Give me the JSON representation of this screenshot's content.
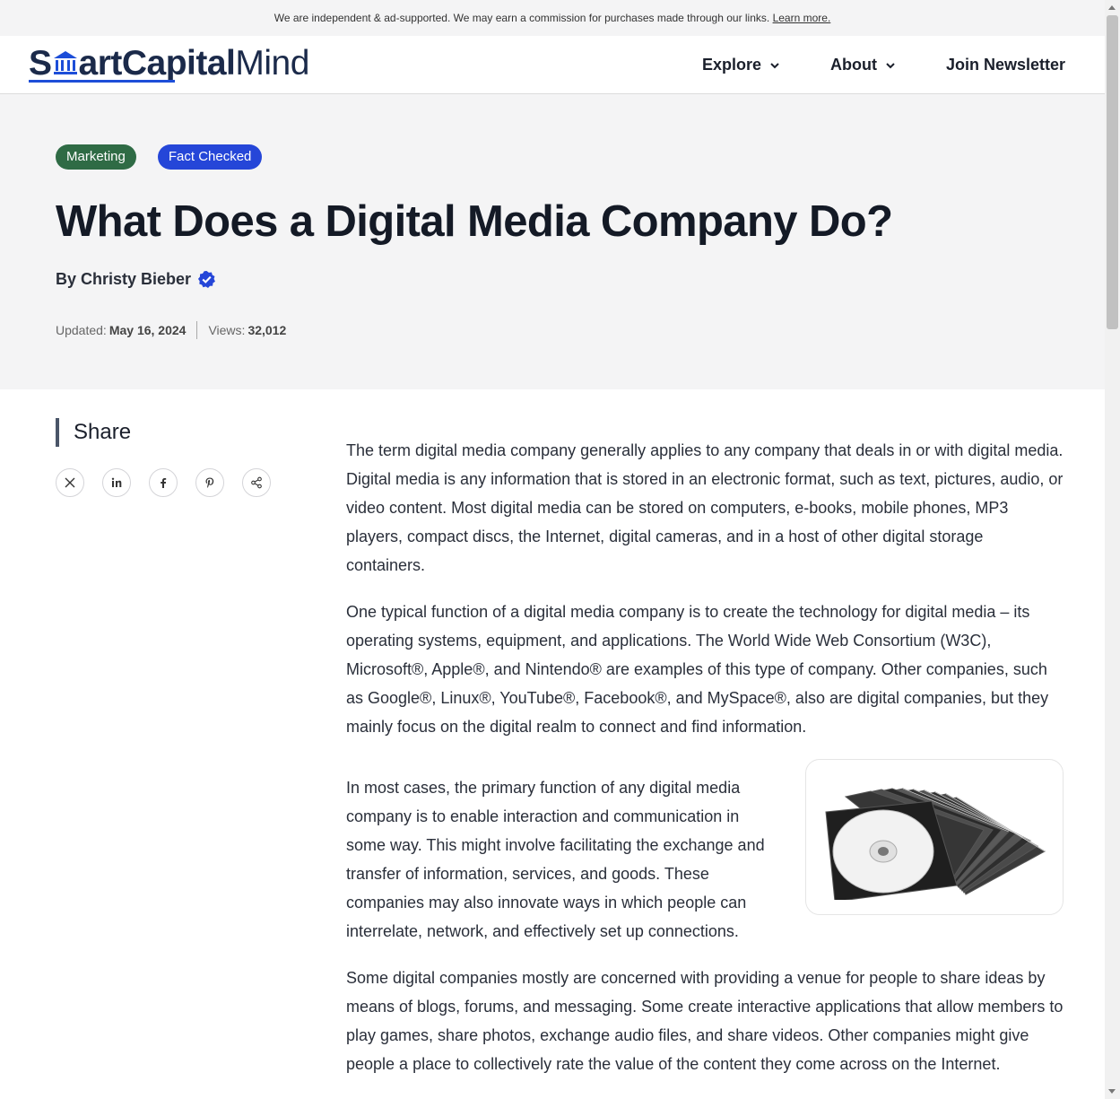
{
  "topbar": {
    "notice": "We are independent & ad-supported. We may earn a commission for purchases made through our links.",
    "learn_more": "Learn more."
  },
  "header": {
    "logo": {
      "part1": "S",
      "part2": "artCapital",
      "part3": "Mind"
    },
    "nav": [
      {
        "label": "Explore",
        "icon": "chevron-down-icon"
      },
      {
        "label": "About",
        "icon": "chevron-down-icon"
      },
      {
        "label": "Join Newsletter"
      }
    ],
    "accent_color": "#1d4ed8"
  },
  "hero": {
    "tags": [
      {
        "label": "Marketing",
        "color": "#2f6b45"
      },
      {
        "label": "Fact Checked",
        "color": "#2546d8"
      }
    ],
    "title": "What Does a Digital Media Company Do?",
    "author": "By Christy Bieber",
    "updated_label": "Updated:",
    "updated_value": "May 16, 2024",
    "views_label": "Views:",
    "views_value": "32,012"
  },
  "share": {
    "title": "Share",
    "icons": [
      "x-icon",
      "linkedin-icon",
      "facebook-icon",
      "pinterest-icon",
      "share-icon"
    ]
  },
  "article": {
    "p1": "The term digital media company generally applies to any company that deals in or with digital media. Digital media is any information that is stored in an electronic format, such as text, pictures, audio, or video content. Most digital media can be stored on computers, e-books, mobile phones, MP3 players, compact discs, the Internet, digital cameras, and in a host of other digital storage containers.",
    "p2": "One typical function of a digital media company is to create the technology for digital media – its operating systems, equipment, and applications. The World Wide Web Consortium (W3C), Microsoft®, Apple®, and Nintendo® are examples of this type of company. Other companies, such as Google®, Linux®, YouTube®, Facebook®, and MySpace®, also are digital companies, but they mainly focus on the digital realm to connect and find information.",
    "p3": "In most cases, the primary function of any digital media company is to enable interaction and communication in some way. This might involve facilitating the exchange and transfer of information, services, and goods. These companies may also innovate ways in which people can interrelate, network, and effectively set up connections.",
    "p4": "Some digital companies mostly are concerned with providing a venue for people to share ideas by means of blogs, forums, and messaging. Some create interactive applications that allow members to play games, share photos, exchange audio files, and share videos. Other companies might give people a place to collectively rate the value of the content they come across on the Internet."
  }
}
